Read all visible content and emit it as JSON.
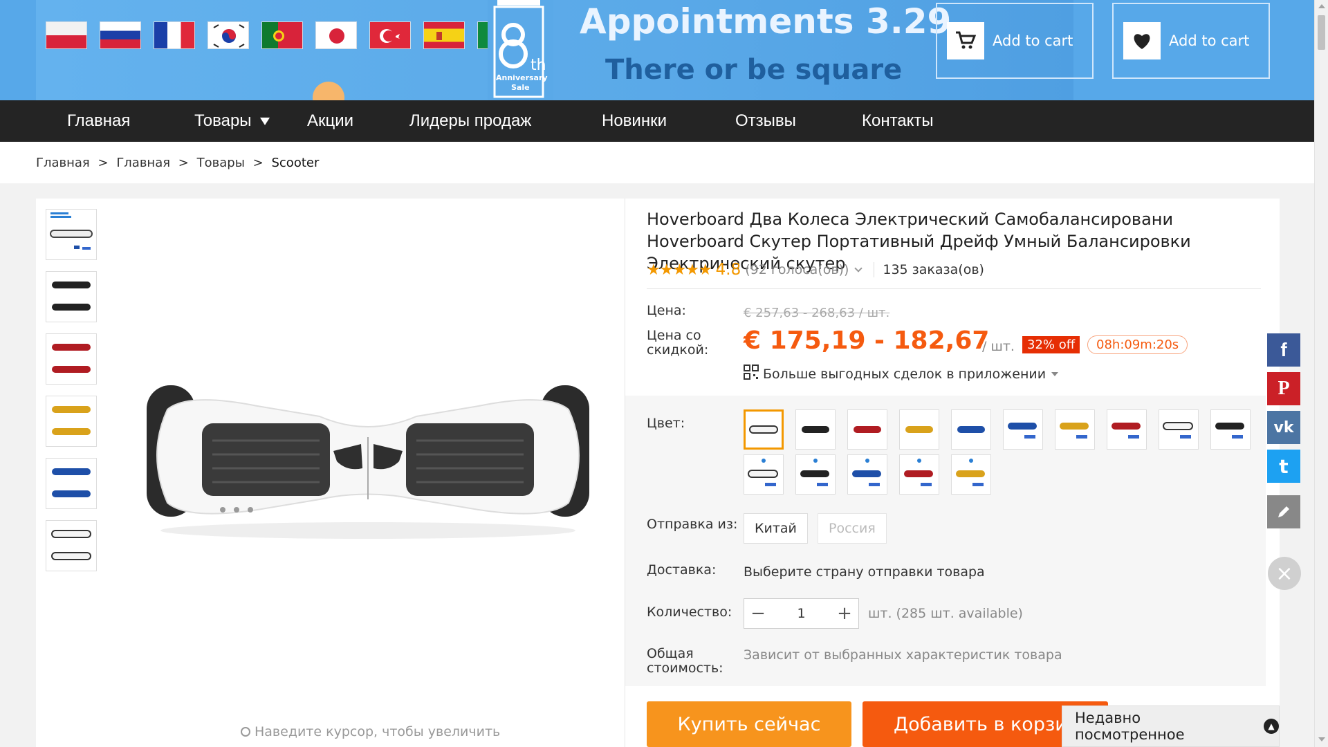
{
  "banner": {
    "title": "Appointments 3.29",
    "subtitle": "There or be square",
    "anniversary_big": "8",
    "anniversary_th": "th",
    "anniversary_line1": "Anniversary",
    "anniversary_line2": "Sale",
    "add_to_cart_1": "Add to cart",
    "add_to_cart_2": "Add to cart"
  },
  "nav": {
    "home": "Главная",
    "products": "Товары",
    "promotions": "Акции",
    "bestsellers": "Лидеры продаж",
    "new": "Новинки",
    "reviews": "Отзывы",
    "contacts": "Контакты"
  },
  "breadcrumb": [
    "Главная",
    ">",
    "Главная",
    ">",
    "Товары",
    ">",
    "Scooter"
  ],
  "product": {
    "title": "Hoverboard Два Колеса Электрический Самобалансировани Hoverboard Скутер Портативный Дрейф Умный Балансировки Электрический скутер",
    "stars": "★★★★★",
    "rating": "4.8",
    "votes": "(92 голоса(ов))",
    "orders": "135 заказа(ов)",
    "price_label": "Цена:",
    "old_price": "€ 257,63 - 268,63 / шт.",
    "discount_label": "Цена со скидкой:",
    "price": "€ 175,19 - 182,67",
    "unit": "/ шт.",
    "off_badge": "32% off",
    "timer": "08h:09m:20s",
    "app_deals": "Больше выгодных сделок в приложении",
    "color_label": "Цвет:",
    "ship_from_label": "Отправка из:",
    "ship_china": "Китай",
    "ship_russia": "Россия",
    "delivery_label": "Доставка:",
    "delivery_value": "Выберите страну отправки товара",
    "qty_label": "Количество:",
    "qty_value": "1",
    "qty_available": "шт. (285 шт. available)",
    "total_label": "Общая стоимость:",
    "total_value": "Зависит от выбранных характеристик товара",
    "buy_now": "Купить сейчас",
    "add_to_cart": "Добавить в корзину",
    "zoom_hint": "Наведите курсор, чтобы увеличить"
  },
  "recently_viewed": "Недавно посмотренное",
  "colors": {
    "accent_orange": "#f55a0f",
    "buy_orange": "#f7941d",
    "nav_bg": "#242424",
    "banner_blue": "#57a8e9",
    "facebook": "#3b5998",
    "pinterest": "#cb2027",
    "vk": "#4c75a3",
    "twitter": "#1da1f2"
  },
  "social": {
    "facebook": "f",
    "pinterest": "P",
    "vk": "vk",
    "twitter": "t"
  }
}
